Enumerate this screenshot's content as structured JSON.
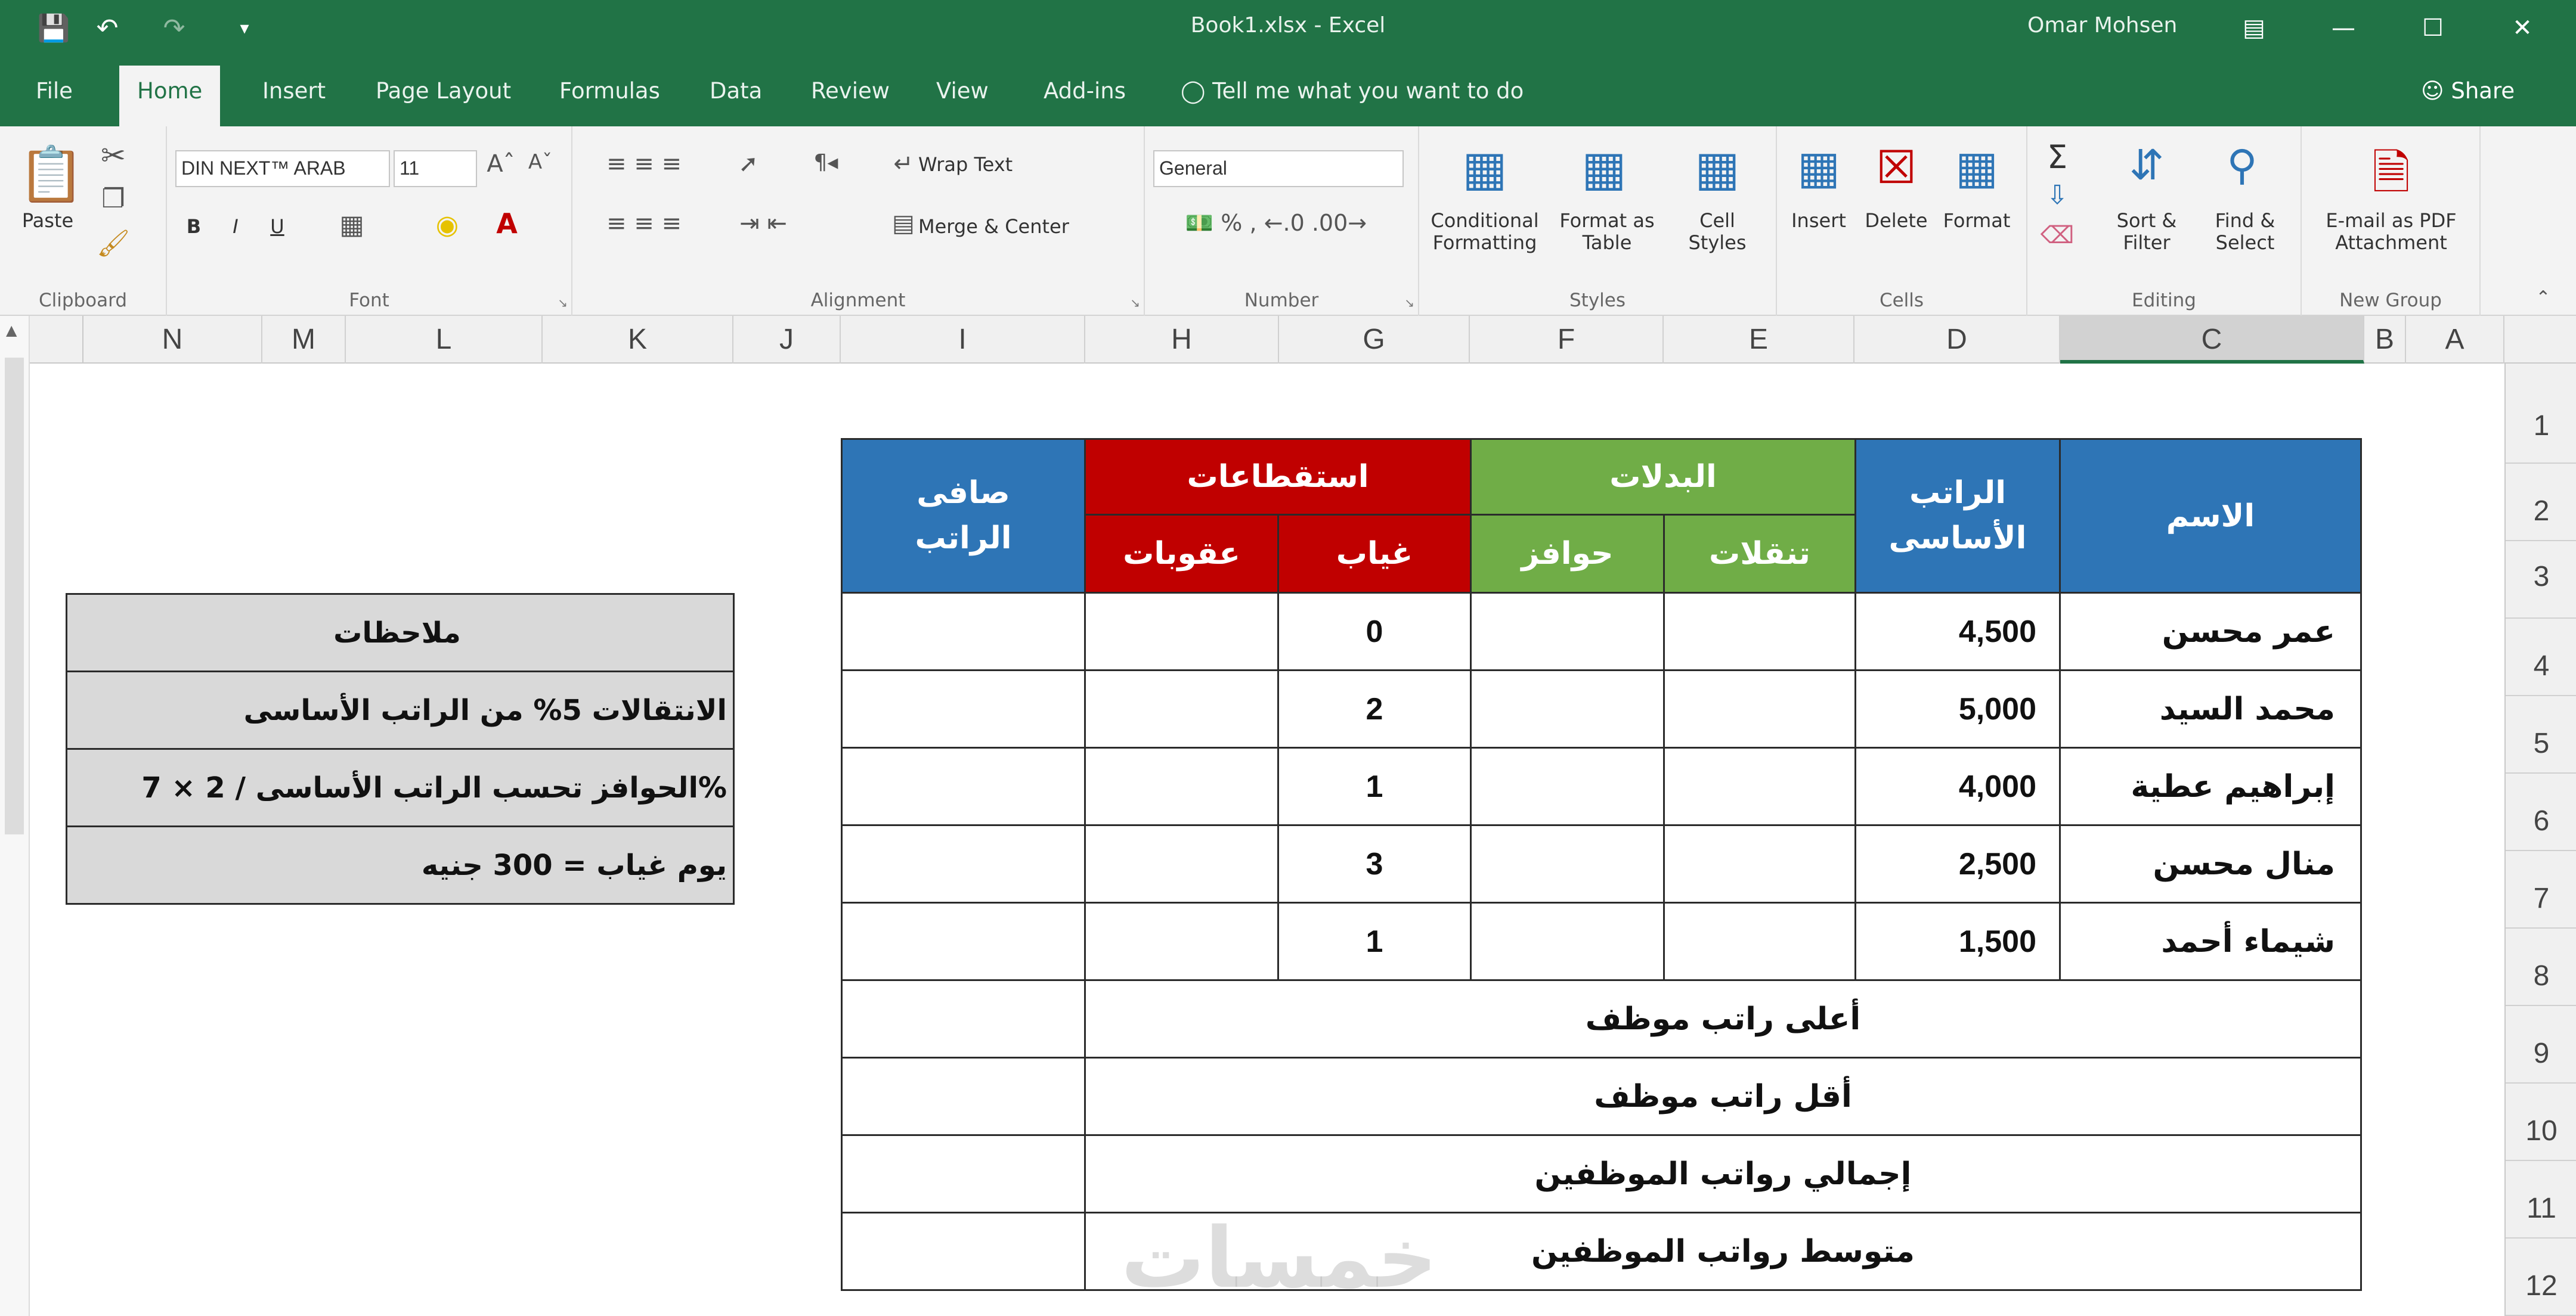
{
  "app": {
    "doc_title": "Book1.xlsx - Excel",
    "user_name": "Omar Mohsen",
    "share_label": "Share",
    "tell_me": "Tell me what you want to do"
  },
  "tabs": [
    "File",
    "Home",
    "Insert",
    "Page Layout",
    "Formulas",
    "Data",
    "Review",
    "View",
    "Add-ins"
  ],
  "ribbon": {
    "clipboard": {
      "label": "Clipboard",
      "paste": "Paste"
    },
    "font": {
      "label": "Font",
      "font_name": "DIN NEXT™ ARAB",
      "font_size": "11",
      "bold": "B",
      "italic": "I",
      "underline": "U"
    },
    "alignment": {
      "label": "Alignment",
      "wrap_text": "Wrap Text",
      "merge_center": "Merge & Center"
    },
    "number": {
      "label": "Number",
      "format": "General"
    },
    "styles": {
      "label": "Styles",
      "conditional_1": "Conditional",
      "conditional_2": "Formatting",
      "format_as_1": "Format as",
      "format_as_2": "Table",
      "cell_styles_1": "Cell",
      "cell_styles_2": "Styles"
    },
    "cells": {
      "label": "Cells",
      "insert": "Insert",
      "delete": "Delete",
      "format": "Format"
    },
    "editing": {
      "label": "Editing",
      "sort_1": "Sort &",
      "sort_2": "Filter",
      "find_1": "Find &",
      "find_2": "Select"
    },
    "new_group": {
      "label": "New Group",
      "email_1": "E-mail as PDF",
      "email_2": "Attachment"
    }
  },
  "columns": [
    "N",
    "M",
    "L",
    "K",
    "J",
    "I",
    "H",
    "G",
    "F",
    "E",
    "D",
    "C",
    "B",
    "A"
  ],
  "rows": [
    "1",
    "2",
    "3",
    "4",
    "5",
    "6",
    "7",
    "8",
    "9",
    "10",
    "11",
    "12"
  ],
  "table": {
    "header": {
      "name": "الاسم",
      "basic_1": "الراتب",
      "basic_2": "الأساسى",
      "allowances": "البدلات",
      "transport": "تنقلات",
      "incentives": "حوافز",
      "deductions": "استقطاعات",
      "absence": "غياب",
      "penalties": "عقوبات",
      "net_1": "صافى",
      "net_2": "الراتب"
    },
    "employees": [
      {
        "name": "عمر محسن",
        "basic": "4,500",
        "absence": "0"
      },
      {
        "name": "محمد السيد",
        "basic": "5,000",
        "absence": "2"
      },
      {
        "name": "إبراهيم عطية",
        "basic": "4,000",
        "absence": "1"
      },
      {
        "name": "منال محسن",
        "basic": "2,500",
        "absence": "3"
      },
      {
        "name": "شيماء أحمد",
        "basic": "1,500",
        "absence": "1"
      }
    ],
    "summary": [
      "أعلى راتب موظف",
      "أقل راتب موظف",
      "إجمالي رواتب الموظفين",
      "متوسط رواتب الموظفين"
    ]
  },
  "notes": {
    "title": "ملاحظات",
    "items": [
      "الانتقالات  5% من الراتب الأساسى",
      "الحوافز تحسب الراتب الأساسى / 2 × 7%",
      "يوم غياب = 300 جنيه"
    ]
  },
  "watermark": "خمسات",
  "colors": {
    "excel_green": "#217346",
    "header_blue": "#2e75b6",
    "header_green": "#70ad47",
    "header_red": "#c00000",
    "notes_gray": "#d9d9d9"
  }
}
